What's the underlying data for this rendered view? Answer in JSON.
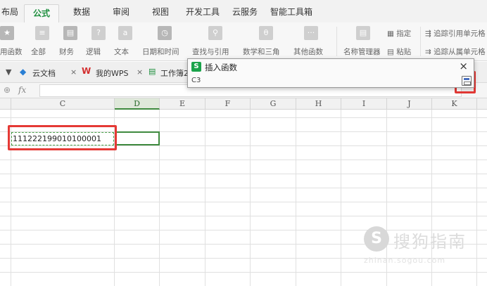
{
  "menu": {
    "tabs": [
      "布局",
      "公式",
      "数据",
      "审阅",
      "视图",
      "开发工具",
      "云服务",
      "智能工具箱"
    ],
    "active": "公式"
  },
  "ribbon": {
    "groups": [
      {
        "label": "用函数",
        "icon": "star-icon"
      },
      {
        "label": "全部",
        "icon": "list-icon"
      },
      {
        "label": "财务",
        "icon": "finance-icon"
      },
      {
        "label": "逻辑",
        "icon": "question-icon"
      },
      {
        "label": "文本",
        "icon": "text-a-icon"
      },
      {
        "label": "日期和时间",
        "icon": "clock-icon"
      },
      {
        "label": "查找与引用",
        "icon": "magnifier-icon"
      },
      {
        "label": "数学和三角",
        "icon": "theta-icon"
      },
      {
        "label": "其他函数",
        "icon": "more-icon"
      },
      {
        "label": "名称管理器",
        "icon": "name-manager-icon"
      }
    ],
    "small_buttons": [
      "指定",
      "粘贴",
      "追踪引用单元格",
      "追踪从属单元格"
    ],
    "icon_glyphs": [
      "★",
      "≡",
      "▤",
      "?",
      "a",
      "◷",
      "⚲",
      "θ",
      "···",
      "▤"
    ]
  },
  "doc_tabs": {
    "items": [
      "云文档",
      "我的WPS",
      "工作簿2"
    ],
    "close_glyph": "×"
  },
  "formula_bar": {
    "zoom_glyph": "⊕",
    "fx_label": "fx",
    "value": ""
  },
  "columns": [
    "C",
    "D",
    "E",
    "F",
    "G",
    "H",
    "I",
    "J",
    "K"
  ],
  "selected_column": "D",
  "cells": {
    "C3": "111222199010100001"
  },
  "dialog": {
    "title": "插入函数",
    "logo": "S",
    "close_glyph": "×",
    "input_value": "C3"
  },
  "watermark": {
    "logo": "S",
    "text": "搜狗指南",
    "url": "zhinan.sogou.com"
  },
  "colors": {
    "accent_green": "#1e8f3e",
    "highlight_red": "#e53935",
    "selection_green": "#3e8a3e"
  }
}
